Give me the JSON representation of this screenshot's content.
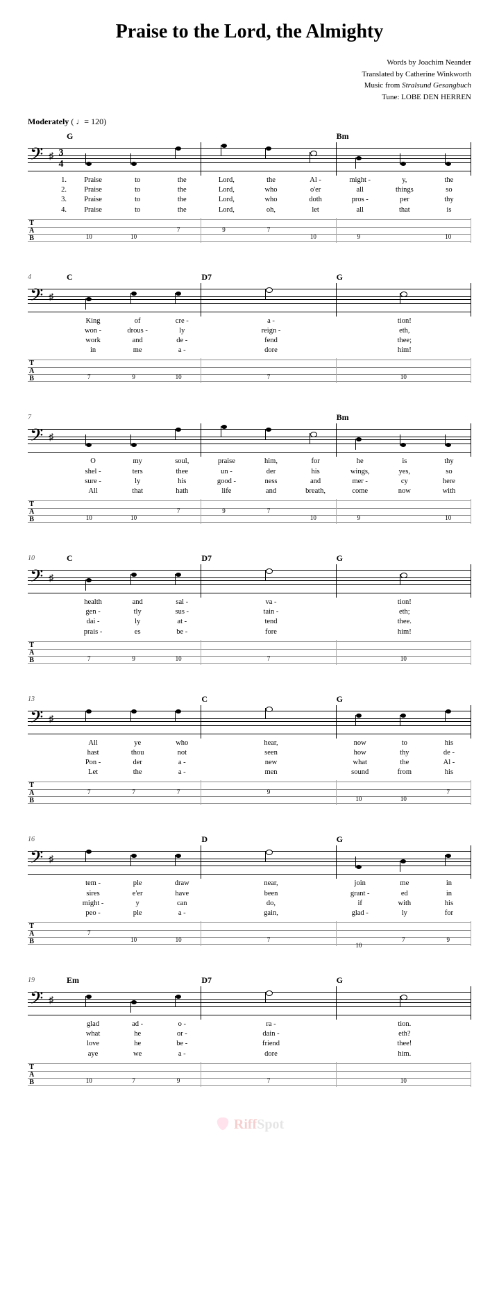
{
  "title": "Praise to the Lord, the Almighty",
  "credits": {
    "line1": "Words by Joachim Neander",
    "line2": "Translated by Catherine Winkworth",
    "line3_prefix": "Music from ",
    "line3_italic": "Stralsund Gesangbuch",
    "line4": "Tune: LOBE DEN HERREN"
  },
  "tempo": {
    "label": "Moderately",
    "marking": "( ♩= 120)"
  },
  "tab_label": [
    "T",
    "A",
    "B"
  ],
  "verse_labels": [
    "1.",
    "2.",
    "3.",
    "4."
  ],
  "watermark": {
    "brand": "Riff",
    "suffix": "Spot"
  },
  "systems": [
    {
      "bar_start": "",
      "first": true,
      "bars": [
        {
          "chord": "G",
          "notes": [
            {
              "p": 4
            },
            {
              "p": 4
            },
            {
              "p": 1
            }
          ],
          "tab": [
            [
              "a",
              "10"
            ],
            [
              "a",
              "10"
            ],
            [
              "d",
              "7"
            ]
          ],
          "lyr": [
            [
              "Praise",
              "to",
              "the"
            ],
            [
              "Praise",
              "to",
              "the"
            ],
            [
              "Praise",
              "to",
              "the"
            ],
            [
              "Praise",
              "to",
              "the"
            ]
          ]
        },
        {
          "chord": "",
          "notes": [
            {
              "p": 0
            },
            {
              "p": 1
            },
            {
              "p": 2,
              "half": true
            }
          ],
          "tab": [
            [
              "d",
              "9"
            ],
            [
              "d",
              "7"
            ],
            [
              "a",
              "10"
            ]
          ],
          "lyr": [
            [
              "Lord,",
              "the",
              "Al -"
            ],
            [
              "Lord,",
              "who",
              "o'er"
            ],
            [
              "Lord,",
              "who",
              "doth"
            ],
            [
              "Lord,",
              "oh,",
              "let"
            ]
          ]
        },
        {
          "chord": "Bm",
          "notes": [
            {
              "p": 3
            },
            {
              "p": 4
            },
            {
              "p": 4
            }
          ],
          "tab": [
            [
              "a",
              "9"
            ],
            [
              "",
              ""
            ],
            [
              "a",
              "10"
            ]
          ],
          "lyr": [
            [
              "might -",
              "y,",
              "the"
            ],
            [
              "all",
              "things",
              "so"
            ],
            [
              "pros -",
              "per",
              "thy"
            ],
            [
              "all",
              "that",
              "is"
            ]
          ]
        }
      ]
    },
    {
      "bar_start": "4",
      "bars": [
        {
          "chord": "C",
          "notes": [
            {
              "p": 3
            },
            {
              "p": 2
            },
            {
              "p": 2
            }
          ],
          "tab": [
            [
              "a",
              "7"
            ],
            [
              "a",
              "9"
            ],
            [
              "a",
              "10"
            ]
          ],
          "lyr": [
            [
              "King",
              "of",
              "cre -"
            ],
            [
              "won -",
              "drous -",
              "ly"
            ],
            [
              "work",
              "and",
              "de -"
            ],
            [
              "in",
              "me",
              "a -"
            ]
          ]
        },
        {
          "chord": "D7",
          "notes": [
            {
              "p": 1,
              "half": true
            }
          ],
          "tab": [
            [
              "a",
              "7"
            ]
          ],
          "lyr": [
            [
              "a -"
            ],
            [
              "reign -"
            ],
            [
              "fend"
            ],
            [
              "dore"
            ]
          ]
        },
        {
          "chord": "G",
          "notes": [
            {
              "p": 2,
              "half": true
            }
          ],
          "tab": [
            [
              "a",
              "10"
            ]
          ],
          "lyr": [
            [
              "tion!"
            ],
            [
              "eth,"
            ],
            [
              "thee;"
            ],
            [
              "him!"
            ]
          ]
        }
      ]
    },
    {
      "bar_start": "7",
      "bars": [
        {
          "chord": "",
          "notes": [
            {
              "p": 4
            },
            {
              "p": 4
            },
            {
              "p": 1
            }
          ],
          "tab": [
            [
              "a",
              "10"
            ],
            [
              "a",
              "10"
            ],
            [
              "d",
              "7"
            ]
          ],
          "lyr": [
            [
              "O",
              "my",
              "soul,"
            ],
            [
              "shel -",
              "ters",
              "thee"
            ],
            [
              "sure -",
              "ly",
              "his"
            ],
            [
              "All",
              "that",
              "hath"
            ]
          ]
        },
        {
          "chord": "",
          "notes": [
            {
              "p": 0
            },
            {
              "p": 1
            },
            {
              "p": 2,
              "half": true
            }
          ],
          "tab": [
            [
              "d",
              "9"
            ],
            [
              "d",
              "7"
            ],
            [
              "a",
              "10"
            ]
          ],
          "lyr": [
            [
              "praise",
              "him,",
              "for"
            ],
            [
              "un -",
              "der",
              "his"
            ],
            [
              "good -",
              "ness",
              "and"
            ],
            [
              "life",
              "and",
              "breath,"
            ]
          ]
        },
        {
          "chord": "Bm",
          "notes": [
            {
              "p": 3
            },
            {
              "p": 4
            },
            {
              "p": 4
            }
          ],
          "tab": [
            [
              "a",
              "9"
            ],
            [
              "",
              ""
            ],
            [
              "a",
              "10"
            ]
          ],
          "lyr": [
            [
              "he",
              "is",
              "thy"
            ],
            [
              "wings,",
              "yes,",
              "so"
            ],
            [
              "mer -",
              "cy",
              "here"
            ],
            [
              "come",
              "now",
              "with"
            ]
          ]
        }
      ]
    },
    {
      "bar_start": "10",
      "bars": [
        {
          "chord": "C",
          "notes": [
            {
              "p": 3
            },
            {
              "p": 2
            },
            {
              "p": 2
            }
          ],
          "tab": [
            [
              "a",
              "7"
            ],
            [
              "a",
              "9"
            ],
            [
              "a",
              "10"
            ]
          ],
          "lyr": [
            [
              "health",
              "and",
              "sal -"
            ],
            [
              "gen -",
              "tly",
              "sus -"
            ],
            [
              "dai -",
              "ly",
              "at -"
            ],
            [
              "prais -",
              "es",
              "be -"
            ]
          ]
        },
        {
          "chord": "D7",
          "notes": [
            {
              "p": 1,
              "half": true
            }
          ],
          "tab": [
            [
              "a",
              "7"
            ]
          ],
          "lyr": [
            [
              "va -"
            ],
            [
              "tain -"
            ],
            [
              "tend"
            ],
            [
              "fore"
            ]
          ]
        },
        {
          "chord": "G",
          "notes": [
            {
              "p": 2,
              "half": true
            }
          ],
          "tab": [
            [
              "a",
              "10"
            ]
          ],
          "lyr": [
            [
              "tion!"
            ],
            [
              "eth;"
            ],
            [
              "thee."
            ],
            [
              "him!"
            ]
          ]
        }
      ]
    },
    {
      "bar_start": "13",
      "bars": [
        {
          "chord": "",
          "notes": [
            {
              "p": 1
            },
            {
              "p": 1
            },
            {
              "p": 1
            }
          ],
          "tab": [
            [
              "d",
              "7"
            ],
            [
              "d",
              "7"
            ],
            [
              "d",
              "7"
            ]
          ],
          "lyr": [
            [
              "All",
              "ye",
              "who"
            ],
            [
              "hast",
              "thou",
              "not"
            ],
            [
              "Pon -",
              "der",
              "a -"
            ],
            [
              "Let",
              "the",
              "a -"
            ]
          ]
        },
        {
          "chord": "C",
          "notes": [
            {
              "p": 0,
              "half": true
            }
          ],
          "tab": [
            [
              "d",
              "9"
            ]
          ],
          "lyr": [
            [
              "hear,"
            ],
            [
              "seen"
            ],
            [
              "new"
            ],
            [
              "men"
            ]
          ]
        },
        {
          "chord": "G",
          "notes": [
            {
              "p": 2
            },
            {
              "p": 2
            },
            {
              "p": 1
            }
          ],
          "tab": [
            [
              "a",
              "10"
            ],
            [
              "a",
              "10"
            ],
            [
              "d",
              "7"
            ]
          ],
          "lyr": [
            [
              "now",
              "to",
              "his"
            ],
            [
              "how",
              "thy",
              "de -"
            ],
            [
              "what",
              "the",
              "Al -"
            ],
            [
              "sound",
              "from",
              "his"
            ]
          ]
        }
      ]
    },
    {
      "bar_start": "16",
      "bars": [
        {
          "chord": "",
          "notes": [
            {
              "p": 1
            },
            {
              "p": 2
            },
            {
              "p": 2
            }
          ],
          "tab": [
            [
              "d",
              "7"
            ],
            [
              "a",
              "10"
            ],
            [
              "a",
              "10"
            ]
          ],
          "lyr": [
            [
              "tem -",
              "ple",
              "draw"
            ],
            [
              "sires",
              "e'er",
              "have"
            ],
            [
              "might -",
              "y",
              "can"
            ],
            [
              "peo -",
              "ple",
              "a -"
            ]
          ]
        },
        {
          "chord": "D",
          "notes": [
            {
              "p": 1,
              "half": true
            }
          ],
          "tab": [
            [
              "a",
              "7"
            ]
          ],
          "lyr": [
            [
              "near,"
            ],
            [
              "been"
            ],
            [
              "do,"
            ],
            [
              "gain,"
            ]
          ]
        },
        {
          "chord": "G",
          "notes": [
            {
              "p": 4
            },
            {
              "p": 3
            },
            {
              "p": 2
            }
          ],
          "tab": [
            [
              "e",
              "10"
            ],
            [
              "a",
              "7"
            ],
            [
              "a",
              "9"
            ]
          ],
          "lyr": [
            [
              "join",
              "me",
              "in"
            ],
            [
              "grant -",
              "ed",
              "in"
            ],
            [
              "if",
              "with",
              "his"
            ],
            [
              "glad -",
              "ly",
              "for"
            ]
          ]
        }
      ]
    },
    {
      "bar_start": "19",
      "bars": [
        {
          "chord": "Em",
          "notes": [
            {
              "p": 2
            },
            {
              "p": 3
            },
            {
              "p": 2
            }
          ],
          "tab": [
            [
              "a",
              "10"
            ],
            [
              "a",
              "7"
            ],
            [
              "a",
              "9"
            ]
          ],
          "lyr": [
            [
              "glad",
              "ad -",
              "o -"
            ],
            [
              "what",
              "he",
              "or -"
            ],
            [
              "love",
              "he",
              "be -"
            ],
            [
              "aye",
              "we",
              "a -"
            ]
          ]
        },
        {
          "chord": "D7",
          "notes": [
            {
              "p": 1,
              "half": true
            }
          ],
          "tab": [
            [
              "a",
              "7"
            ]
          ],
          "lyr": [
            [
              "ra -"
            ],
            [
              "dain -"
            ],
            [
              "friend"
            ],
            [
              "dore"
            ]
          ]
        },
        {
          "chord": "G",
          "notes": [
            {
              "p": 2,
              "half": true
            }
          ],
          "tab": [
            [
              "a",
              "10"
            ]
          ],
          "lyr": [
            [
              "tion."
            ],
            [
              "eth?"
            ],
            [
              "thee!"
            ],
            [
              "him."
            ]
          ]
        }
      ]
    }
  ]
}
